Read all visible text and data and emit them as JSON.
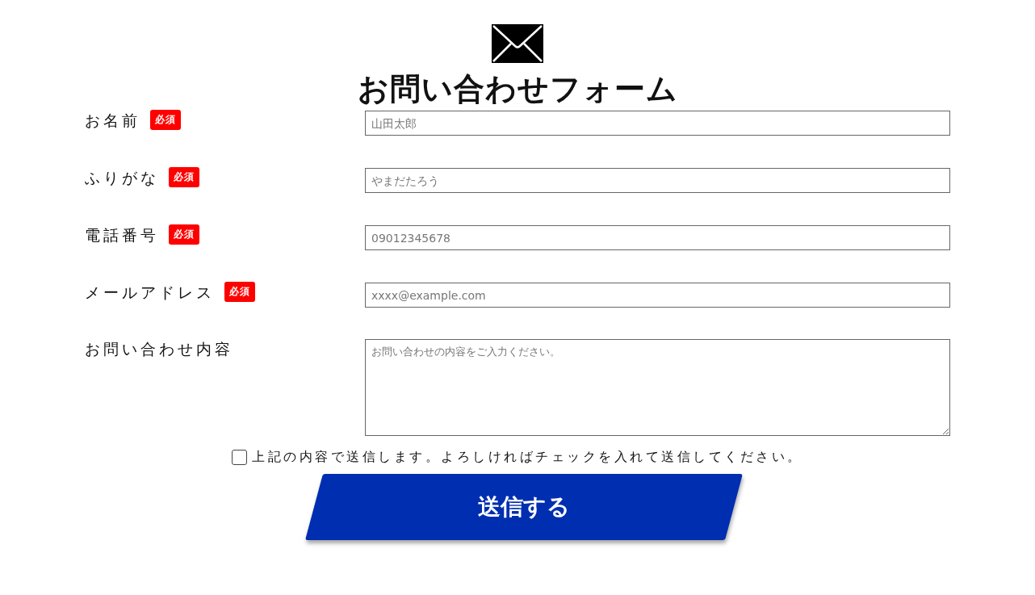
{
  "title": "お問い合わせフォーム",
  "fields": [
    {
      "label": "お名前",
      "required": true,
      "badge": "必須",
      "kind": "input",
      "placeholder": "山田太郎"
    },
    {
      "label": "ふりがな",
      "required": true,
      "badge": "必須",
      "kind": "input",
      "placeholder": "やまだたろう"
    },
    {
      "label": "電話番号",
      "required": true,
      "badge": "必須",
      "kind": "input",
      "placeholder": "09012345678"
    },
    {
      "label": "メールアドレス",
      "required": true,
      "badge": "必須",
      "kind": "input",
      "placeholder": "xxxx@example.com"
    },
    {
      "label": "お問い合わせ内容",
      "required": false,
      "kind": "textarea",
      "placeholder": "お問い合わせの内容をご入力ください。"
    }
  ],
  "consent": {
    "label": "上記の内容で送信します。よろしければチェックを入れて送信してください。",
    "checked": false
  },
  "submit": "送信する"
}
